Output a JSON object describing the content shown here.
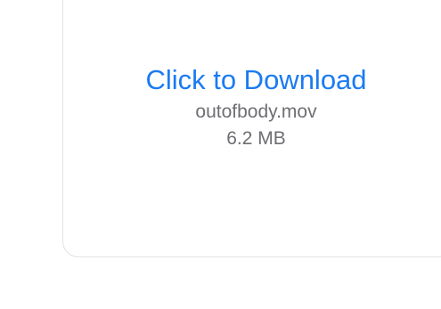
{
  "download": {
    "link_label": "Click to Download",
    "filename": "outofbody.mov",
    "filesize": "6.2 MB"
  },
  "colors": {
    "link": "#1a7bf2",
    "meta_text": "#6e6e73",
    "card_border": "#e3e3e3",
    "background": "#ffffff"
  }
}
